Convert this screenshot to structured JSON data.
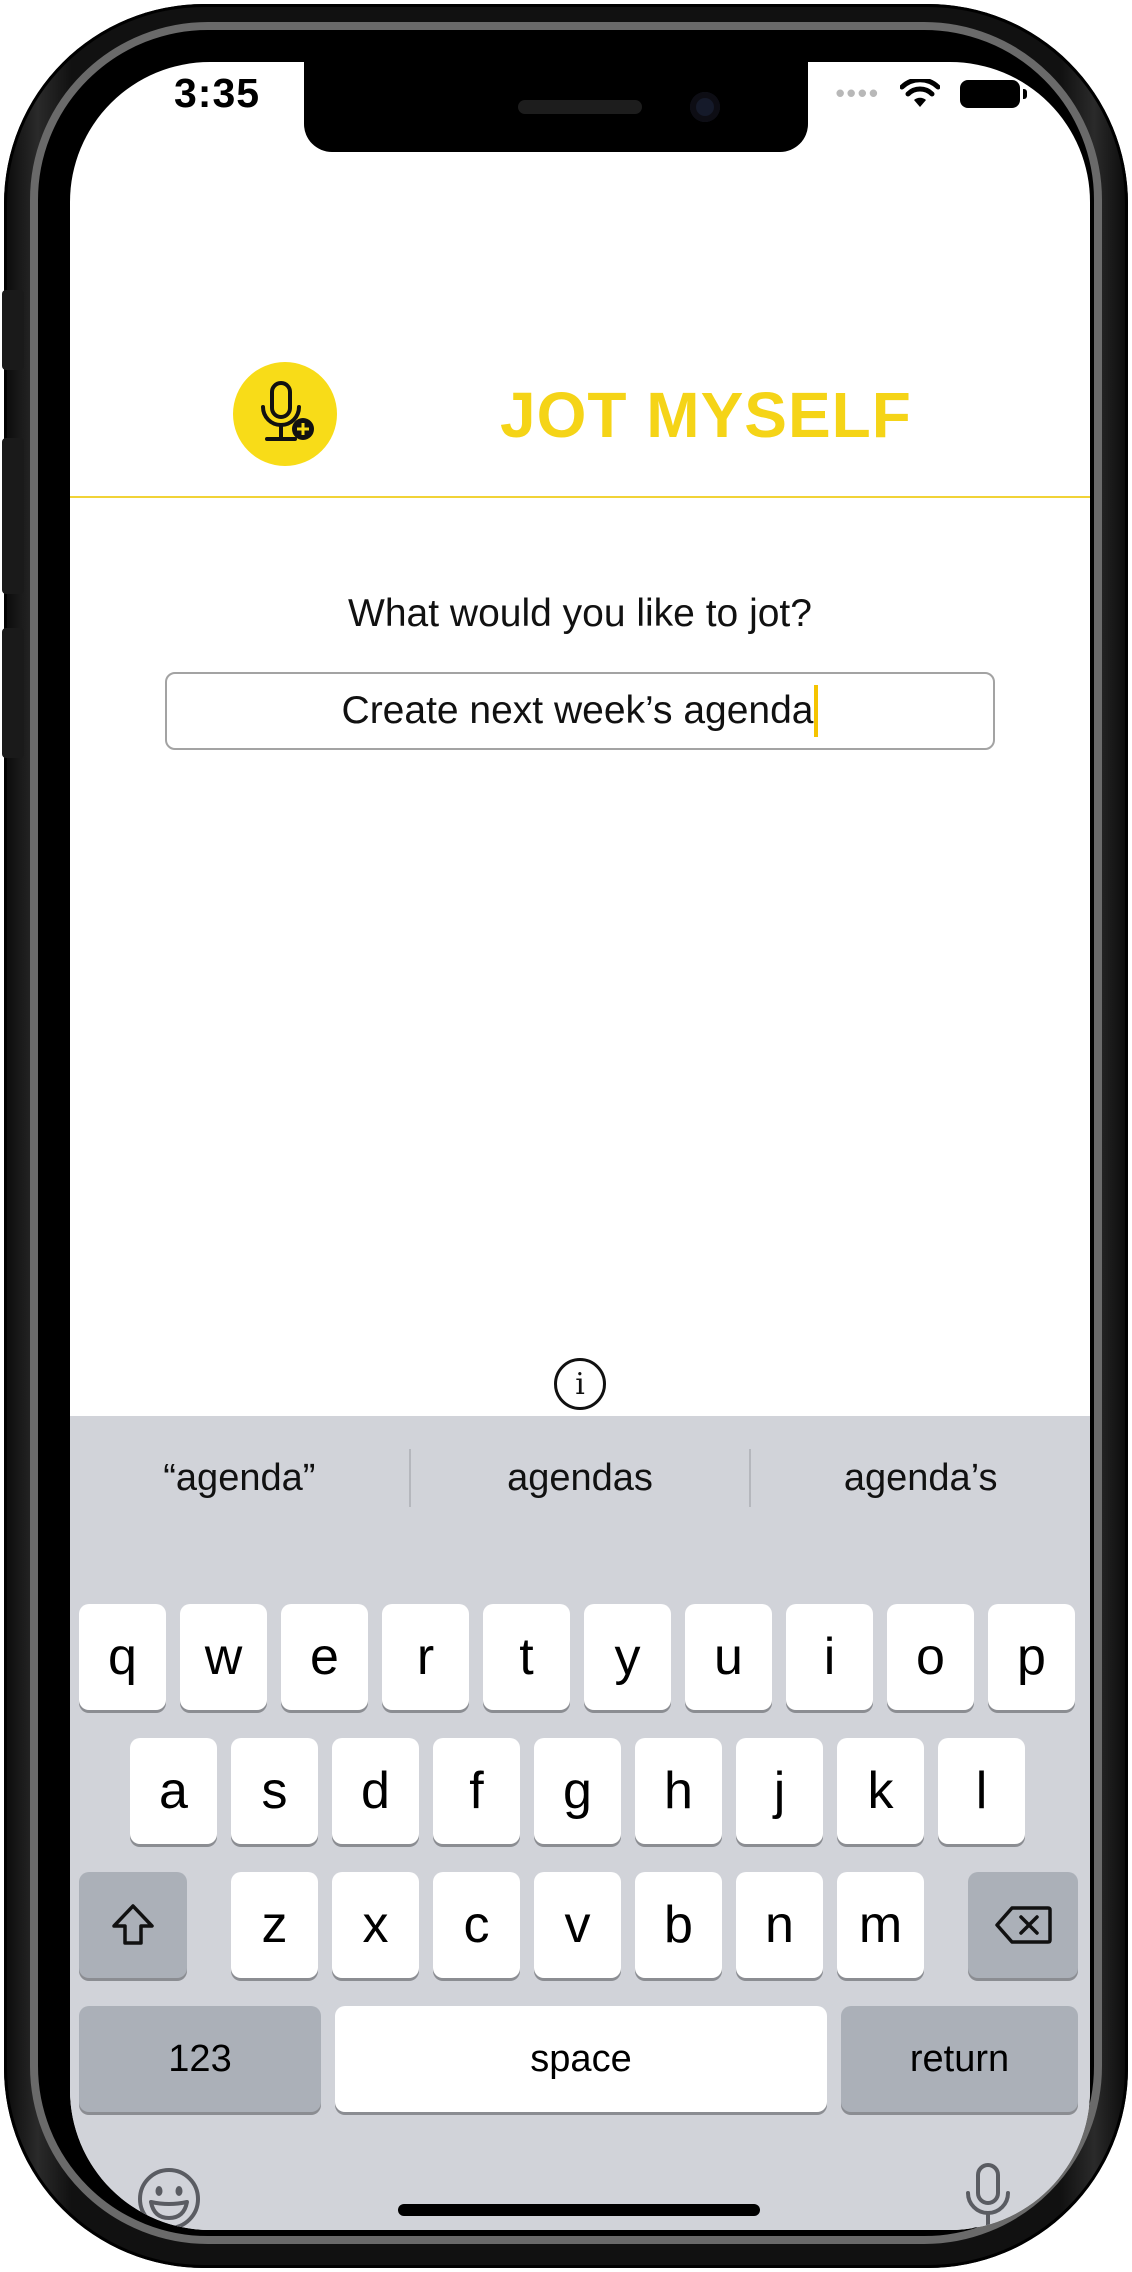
{
  "status_bar": {
    "time": "3:35",
    "signal_icon": "signal-dots-icon",
    "wifi_icon": "wifi-icon",
    "battery_icon": "battery-icon"
  },
  "header": {
    "logo_icon": "microphone-plus-icon",
    "title": "JOT MYSELF",
    "accent_color": "#f5d417"
  },
  "main": {
    "prompt": "What would you like to jot?",
    "input_value": "Create next week’s agenda",
    "info_icon": "info-circle-icon"
  },
  "keyboard": {
    "suggestions": [
      "“agenda”",
      "agendas",
      "agenda’s"
    ],
    "row1": [
      "q",
      "w",
      "e",
      "r",
      "t",
      "y",
      "u",
      "i",
      "o",
      "p"
    ],
    "row2": [
      "a",
      "s",
      "d",
      "f",
      "g",
      "h",
      "j",
      "k",
      "l"
    ],
    "row3": [
      "z",
      "x",
      "c",
      "v",
      "b",
      "n",
      "m"
    ],
    "numbers_label": "123",
    "space_label": "space",
    "return_label": "return",
    "shift_icon": "shift-arrow-icon",
    "delete_icon": "backspace-icon",
    "emoji_icon": "emoji-face-icon",
    "dictation_icon": "microphone-icon"
  }
}
